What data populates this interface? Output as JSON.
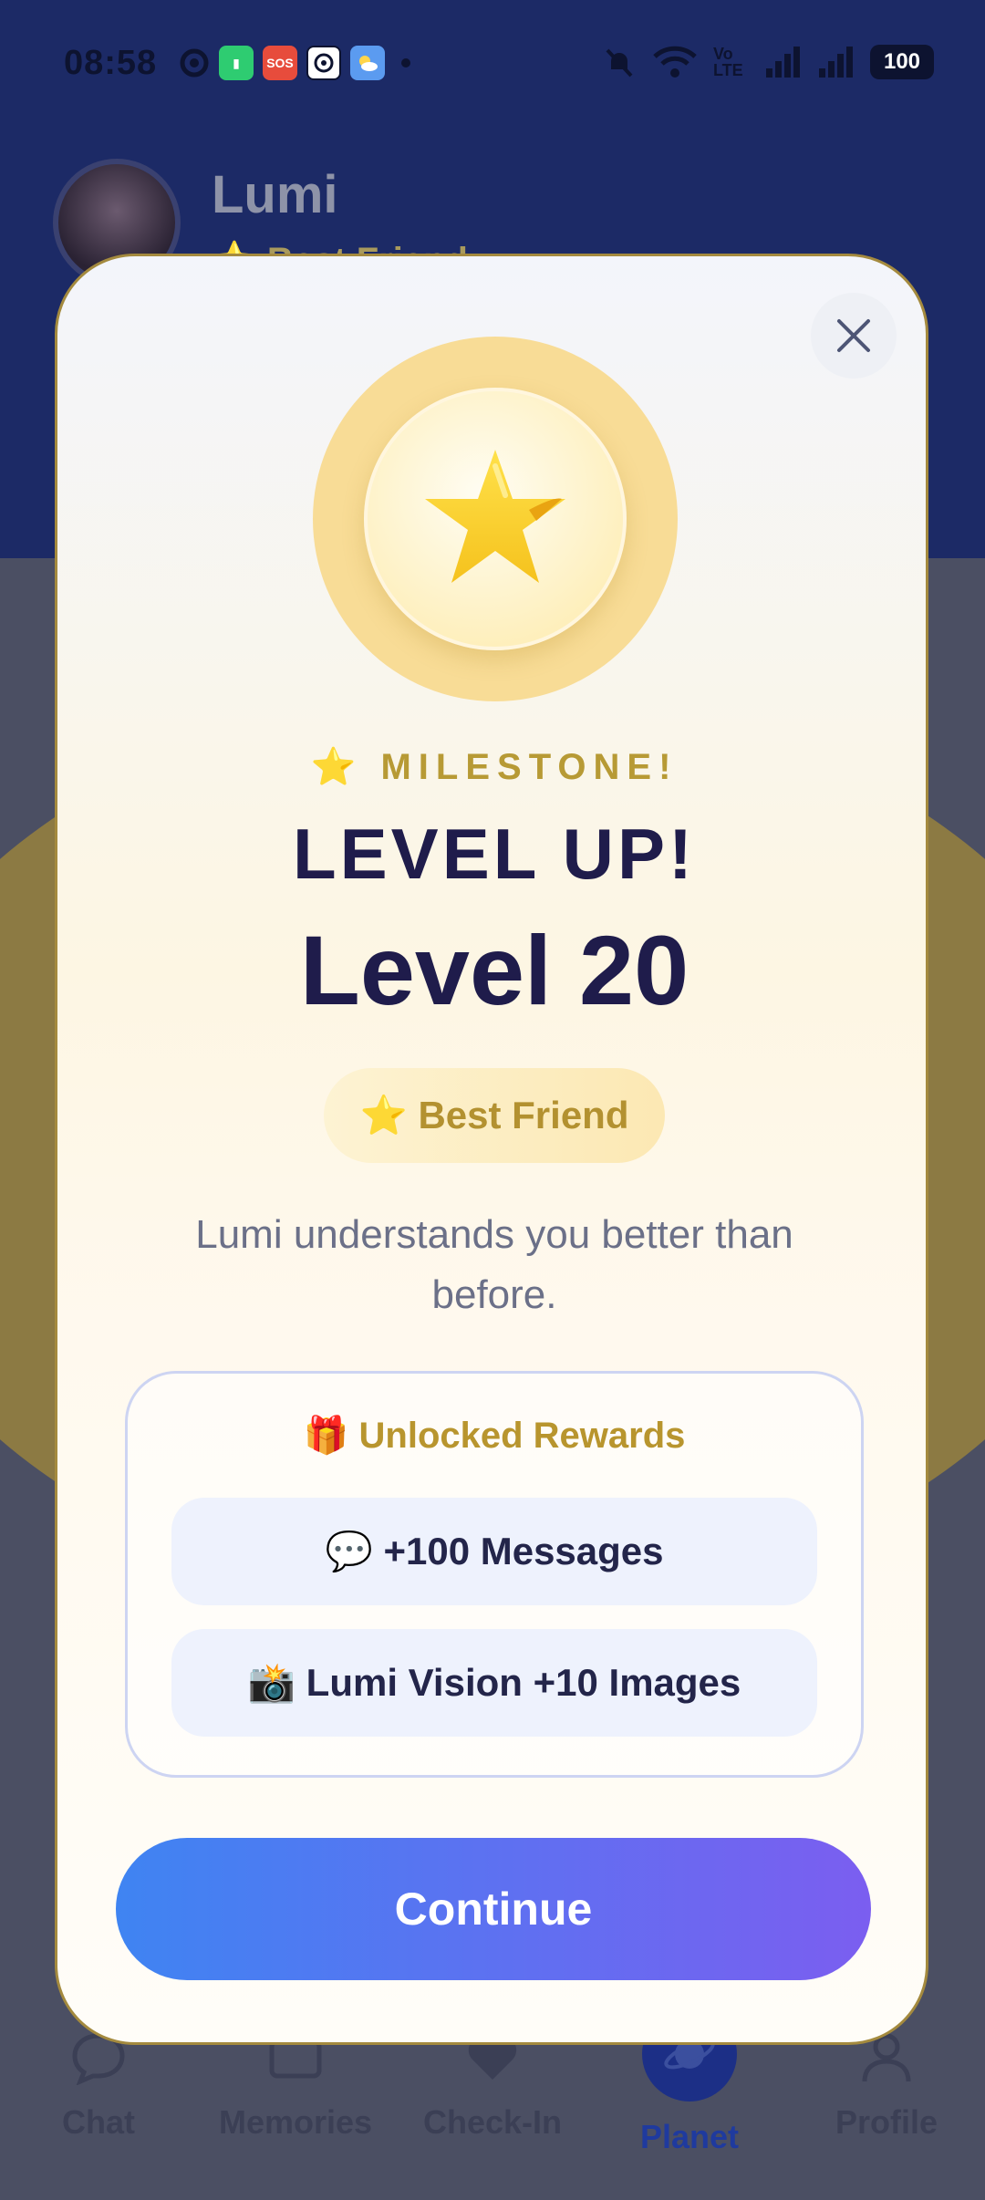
{
  "status_bar": {
    "time": "08:58",
    "battery": "100",
    "network_label": "Vo LTE"
  },
  "profile": {
    "name": "Lumi",
    "subtitle": "⭐ Best Friend"
  },
  "modal": {
    "milestone_label": "⭐  MILESTONE!",
    "heading": "LEVEL UP!",
    "level": "Level 20",
    "tier": "⭐ Best Friend",
    "description": "Lumi understands you better than before.",
    "rewards": {
      "title": "🎁 Unlocked Rewards",
      "items": [
        {
          "label": "💬 +100 Messages"
        },
        {
          "label": "📸 Lumi Vision +10 Images"
        }
      ]
    },
    "continue_label": "Continue"
  },
  "tabs": [
    {
      "label": "Chat",
      "icon": "chat-bubble-icon",
      "active": false
    },
    {
      "label": "Memories",
      "icon": "memories-icon",
      "active": false
    },
    {
      "label": "Check-In",
      "icon": "heart-icon",
      "active": false
    },
    {
      "label": "Planet",
      "icon": "planet-icon",
      "active": true
    },
    {
      "label": "Profile",
      "icon": "person-icon",
      "active": false
    }
  ],
  "colors": {
    "accent_blue": "#3f84f2",
    "accent_purple": "#7b5ef0",
    "gold": "#b79a35",
    "heading_navy": "#1f1c4b"
  }
}
